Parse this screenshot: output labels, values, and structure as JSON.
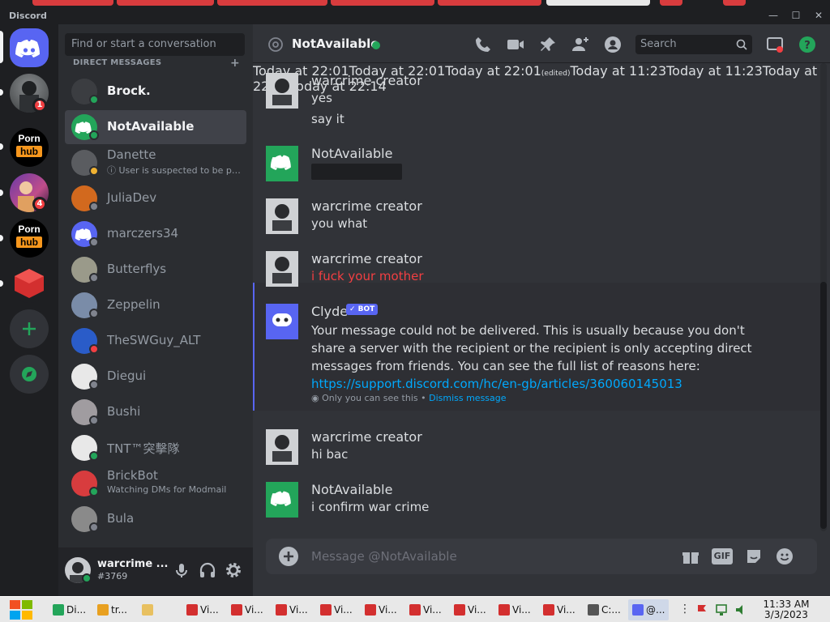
{
  "window": {
    "app_title": "Discord"
  },
  "servers": {
    "home_icon": "discord-logo-icon",
    "badges": [
      "1",
      "4"
    ],
    "hub1": {
      "top": "Porn",
      "bottom": "hub"
    },
    "hub2": {
      "top": "Porn",
      "bottom": "hub"
    },
    "add_icon": "plus-icon",
    "explore_icon": "compass-icon"
  },
  "dm_panel": {
    "search_placeholder": "Find or start a conversation",
    "section_title": "DIRECT MESSAGES",
    "add_dm_icon": "plus-icon",
    "items": [
      {
        "name": "Brock.",
        "sub": ""
      },
      {
        "name": "NotAvailable",
        "sub": ""
      },
      {
        "name": "Danette",
        "sub": "ⓘ User is suspected to be part of an online terror group."
      },
      {
        "name": "JuliaDev",
        "sub": ""
      },
      {
        "name": "marczers34",
        "sub": ""
      },
      {
        "name": "Butterflys",
        "sub": ""
      },
      {
        "name": "Zeppelin",
        "sub": ""
      },
      {
        "name": "TheSWGuy_ALT",
        "sub": ""
      },
      {
        "name": "Diegui",
        "sub": ""
      },
      {
        "name": "Bushi",
        "sub": ""
      },
      {
        "name": "TNT™突擊隊",
        "sub": ""
      },
      {
        "name": "BrickBot",
        "sub": "Watching DMs for Modmail"
      },
      {
        "name": "Bula",
        "sub": ""
      }
    ]
  },
  "user_panel": {
    "name": "warcrime ...",
    "tag": "#3769"
  },
  "chat": {
    "title": "NotAvailable",
    "search_placeholder": "Search",
    "colors": {
      "accent": "#5865f2",
      "online": "#23a55a",
      "link": "#00a8fc",
      "danger": "#f23f42"
    },
    "messages": [
      {
        "author": "warcrime creator",
        "time": "Today at 22:01",
        "lines": [
          "yes",
          "say it"
        ]
      },
      {
        "author": "NotAvailable",
        "time": "Today at 22:01",
        "lines": [
          ""
        ]
      },
      {
        "author": "warcrime creator",
        "time": "Today at 22:01",
        "lines": [
          "you what"
        ],
        "edited": "(edited)"
      },
      {
        "author": "warcrime creator",
        "time": "Today at 11:23",
        "lines": [
          "i fuck your mother"
        ]
      },
      {
        "author": "Clyde",
        "badge": "BOT",
        "time": "Today at 11:23",
        "body": "Your message could not be delivered. This is usually because you don't share a server with the recipient or the recipient is only accepting direct messages from friends. You can see the full list of reasons here: ",
        "link": "https://support.discord.com/hc/en-gb/articles/360060145013",
        "ephemeral": "Only you can see this",
        "dismiss": "Dismiss message"
      },
      {
        "author": "warcrime creator",
        "time": "Today at 22:14",
        "lines": [
          "hi bac"
        ]
      },
      {
        "author": "NotAvailable",
        "time": "Today at 22:14",
        "lines": [
          "i confirm war crime"
        ]
      }
    ],
    "composer_placeholder": "Message @NotAvailable",
    "gif_label": "GIF"
  },
  "taskbar": {
    "items": [
      "Di...",
      "tr...",
      "",
      "Vi...",
      "Vi...",
      "Vi...",
      "Vi...",
      "Vi...",
      "Vi...",
      "Vi...",
      "Vi...",
      "Vi...",
      "C:...",
      "@..."
    ],
    "time": "11:33 AM",
    "date": "3/3/2023"
  }
}
